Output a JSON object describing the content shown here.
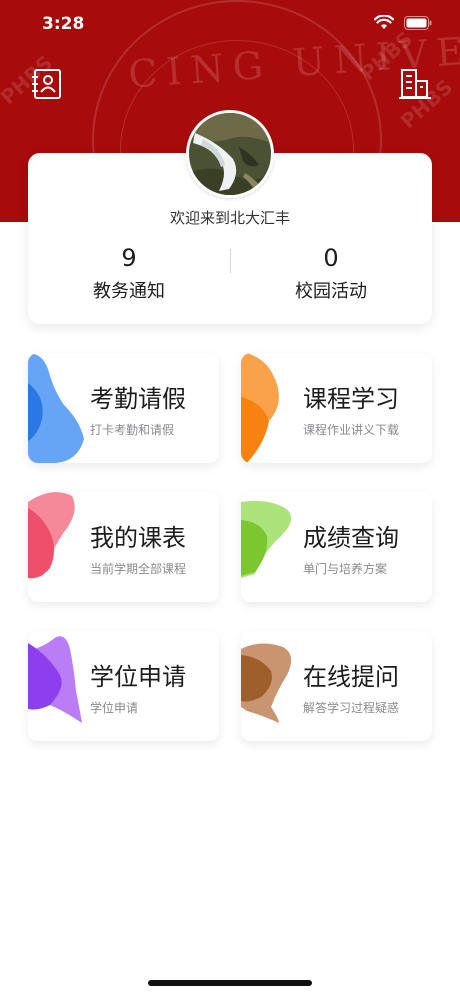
{
  "status_bar": {
    "time": "3:28"
  },
  "header": {
    "watermark_text": "CING UNIVERS",
    "watermark_tags": [
      "PHBS",
      "PHBS",
      "PHBS"
    ],
    "colors": {
      "brand_red": "#a80b0b"
    },
    "icons": {
      "left": "contacts-book-icon",
      "right": "building-icon"
    }
  },
  "profile": {
    "welcome": "欢迎来到北大汇丰",
    "stats": [
      {
        "value": "9",
        "label": "教务通知"
      },
      {
        "value": "0",
        "label": "校园活动"
      }
    ]
  },
  "tiles": [
    {
      "title": "考勤请假",
      "subtitle": "打卡考勤和请假",
      "color": "#4a8ef2"
    },
    {
      "title": "课程学习",
      "subtitle": "课程作业讲义下载",
      "color": "#f78a1e"
    },
    {
      "title": "我的课表",
      "subtitle": "当前学期全部课程",
      "color": "#f04f6c"
    },
    {
      "title": "成绩查询",
      "subtitle": "单门与培养方案",
      "color": "#86cd3b"
    },
    {
      "title": "学位申请",
      "subtitle": "学位申请",
      "color": "#9b4ff0"
    },
    {
      "title": "在线提问",
      "subtitle": "解答学习过程疑惑",
      "color": "#a86a3c"
    }
  ]
}
